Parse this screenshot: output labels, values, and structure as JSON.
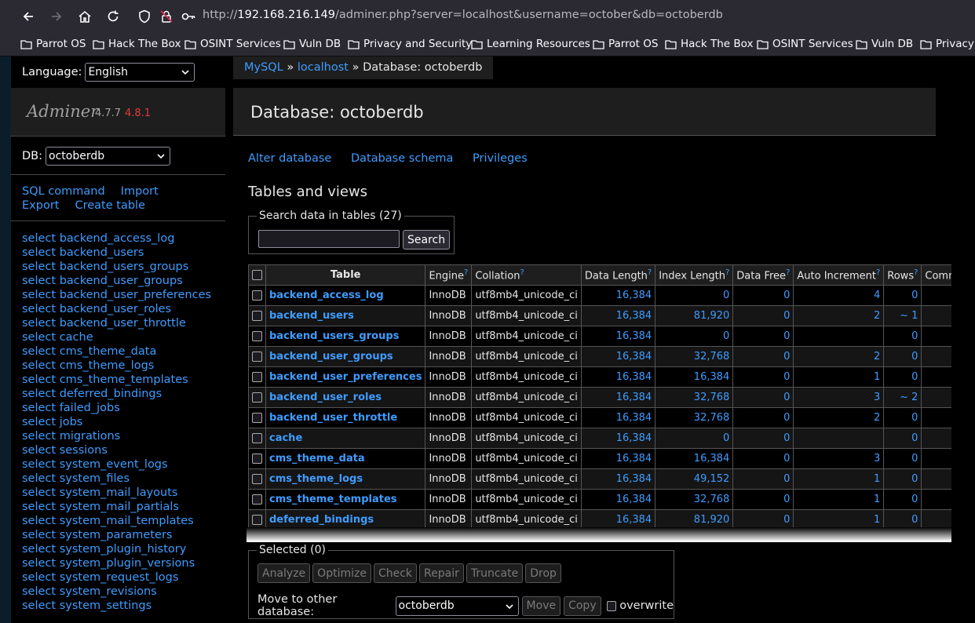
{
  "browser": {
    "url_prefix": "http://",
    "url_host": "192.168.216.149",
    "url_path": "/adminer.php?server=localhost&username=october&db=octoberdb",
    "bookmarks": [
      "Parrot OS",
      "Hack The Box",
      "OSINT Services",
      "Vuln DB",
      "Privacy and Security",
      "Learning Resources",
      "Parrot OS",
      "Hack The Box",
      "OSINT Services",
      "Vuln DB",
      "Privacy a"
    ]
  },
  "sidebar": {
    "language_label": "Language:",
    "language_value": "English",
    "app_name": "Adminer",
    "version": "4.7.7",
    "new_version": "4.8.1",
    "db_label": "DB:",
    "db_value": "octoberdb",
    "sql_command": "SQL command",
    "import": "Import",
    "export": "Export",
    "create_table": "Create table",
    "tables": [
      "select backend_access_log",
      "select backend_users",
      "select backend_users_groups",
      "select backend_user_groups",
      "select backend_user_preferences",
      "select backend_user_roles",
      "select backend_user_throttle",
      "select cache",
      "select cms_theme_data",
      "select cms_theme_logs",
      "select cms_theme_templates",
      "select deferred_bindings",
      "select failed_jobs",
      "select jobs",
      "select migrations",
      "select sessions",
      "select system_event_logs",
      "select system_files",
      "select system_mail_layouts",
      "select system_mail_partials",
      "select system_mail_templates",
      "select system_parameters",
      "select system_plugin_history",
      "select system_plugin_versions",
      "select system_request_logs",
      "select system_revisions",
      "select system_settings"
    ]
  },
  "breadcrumb": {
    "mysql": "MySQL",
    "sep": "»",
    "localhost": "localhost",
    "current": "Database: octoberdb"
  },
  "main": {
    "title": "Database: octoberdb",
    "alter_database": "Alter database",
    "database_schema": "Database schema",
    "privileges": "Privileges",
    "tables_and_views": "Tables and views",
    "search_legend": "Search data in tables (27)",
    "search_button": "Search"
  },
  "table": {
    "headers": {
      "table": "Table",
      "engine": "Engine",
      "collation": "Collation",
      "data_length": "Data Length",
      "index_length": "Index Length",
      "data_free": "Data Free",
      "auto_increment": "Auto Increment",
      "rows": "Rows",
      "comment": "Comment",
      "help": "?"
    },
    "rows": [
      {
        "name": "backend_access_log",
        "engine": "InnoDB",
        "collation": "utf8mb4_unicode_ci",
        "data_length": "16,384",
        "index_length": "0",
        "data_free": "0",
        "auto_increment": "4",
        "rows": "0"
      },
      {
        "name": "backend_users",
        "engine": "InnoDB",
        "collation": "utf8mb4_unicode_ci",
        "data_length": "16,384",
        "index_length": "81,920",
        "data_free": "0",
        "auto_increment": "2",
        "rows": "~ 1"
      },
      {
        "name": "backend_users_groups",
        "engine": "InnoDB",
        "collation": "utf8mb4_unicode_ci",
        "data_length": "16,384",
        "index_length": "0",
        "data_free": "0",
        "auto_increment": "",
        "rows": "0"
      },
      {
        "name": "backend_user_groups",
        "engine": "InnoDB",
        "collation": "utf8mb4_unicode_ci",
        "data_length": "16,384",
        "index_length": "32,768",
        "data_free": "0",
        "auto_increment": "2",
        "rows": "0"
      },
      {
        "name": "backend_user_preferences",
        "engine": "InnoDB",
        "collation": "utf8mb4_unicode_ci",
        "data_length": "16,384",
        "index_length": "16,384",
        "data_free": "0",
        "auto_increment": "1",
        "rows": "0"
      },
      {
        "name": "backend_user_roles",
        "engine": "InnoDB",
        "collation": "utf8mb4_unicode_ci",
        "data_length": "16,384",
        "index_length": "32,768",
        "data_free": "0",
        "auto_increment": "3",
        "rows": "~ 2"
      },
      {
        "name": "backend_user_throttle",
        "engine": "InnoDB",
        "collation": "utf8mb4_unicode_ci",
        "data_length": "16,384",
        "index_length": "32,768",
        "data_free": "0",
        "auto_increment": "2",
        "rows": "0"
      },
      {
        "name": "cache",
        "engine": "InnoDB",
        "collation": "utf8mb4_unicode_ci",
        "data_length": "16,384",
        "index_length": "0",
        "data_free": "0",
        "auto_increment": "",
        "rows": "0"
      },
      {
        "name": "cms_theme_data",
        "engine": "InnoDB",
        "collation": "utf8mb4_unicode_ci",
        "data_length": "16,384",
        "index_length": "16,384",
        "data_free": "0",
        "auto_increment": "3",
        "rows": "0"
      },
      {
        "name": "cms_theme_logs",
        "engine": "InnoDB",
        "collation": "utf8mb4_unicode_ci",
        "data_length": "16,384",
        "index_length": "49,152",
        "data_free": "0",
        "auto_increment": "1",
        "rows": "0"
      },
      {
        "name": "cms_theme_templates",
        "engine": "InnoDB",
        "collation": "utf8mb4_unicode_ci",
        "data_length": "16,384",
        "index_length": "32,768",
        "data_free": "0",
        "auto_increment": "1",
        "rows": "0"
      },
      {
        "name": "deferred_bindings",
        "engine": "InnoDB",
        "collation": "utf8mb4_unicode_ci",
        "data_length": "16,384",
        "index_length": "81,920",
        "data_free": "0",
        "auto_increment": "1",
        "rows": "0"
      }
    ]
  },
  "selection": {
    "legend": "Selected (0)",
    "buttons": [
      "Analyze",
      "Optimize",
      "Check",
      "Repair",
      "Truncate",
      "Drop"
    ],
    "move_label": "Move to other database:",
    "move_target": "octoberdb",
    "move_button": "Move",
    "copy_button": "Copy",
    "overwrite_label": "overwrite"
  }
}
